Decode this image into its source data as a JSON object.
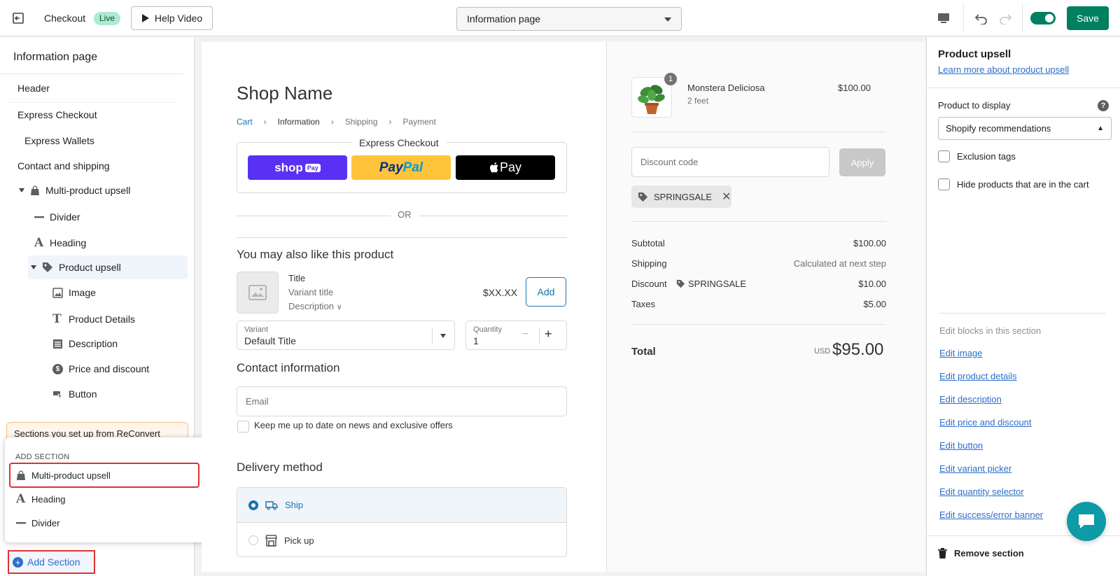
{
  "topbar": {
    "title": "Checkout",
    "status_badge": "Live",
    "help_video_label": "Help Video",
    "page_selector_value": "Information page",
    "save_label": "Save"
  },
  "sidebar": {
    "title": "Information page",
    "items": {
      "header": "Header",
      "express_checkout": "Express Checkout",
      "express_wallets": "Express Wallets",
      "contact_shipping": "Contact and shipping",
      "multi_product_upsell": "Multi-product upsell",
      "divider": "Divider",
      "heading": "Heading",
      "product_upsell": "Product upsell",
      "image": "Image",
      "product_details": "Product Details",
      "description": "Description",
      "price_discount": "Price and discount",
      "button": "Button"
    },
    "notice_text": "Sections you set up from ReConvert",
    "add_section_label": "Add Section"
  },
  "add_section_popover": {
    "title": "ADD SECTION",
    "items": [
      "Multi-product upsell",
      "Heading",
      "Divider"
    ]
  },
  "preview": {
    "shop_name": "Shop Name",
    "breadcrumbs": [
      "Cart",
      "Information",
      "Shipping",
      "Payment"
    ],
    "express_checkout_label": "Express Checkout",
    "shop_pay": {
      "main": "shop",
      "tag": "Pay"
    },
    "paypal": {
      "pay": "Pay",
      "pal": "Pal"
    },
    "apple_pay": "Pay",
    "or_text": "OR",
    "upsell": {
      "heading": "You may also like this product",
      "title": "Title",
      "variant_title": "Variant title",
      "description": "Description",
      "price": "$XX.XX",
      "add_label": "Add",
      "variant_label": "Variant",
      "variant_value": "Default Title",
      "quantity_label": "Quantity",
      "quantity_value": "1"
    },
    "contact_heading": "Contact information",
    "email_placeholder": "Email",
    "newsletter_label": "Keep me up to date on news and exclusive offers",
    "delivery_heading": "Delivery method",
    "delivery_options": {
      "ship": "Ship",
      "pickup": "Pick up"
    }
  },
  "summary": {
    "product": {
      "name": "Monstera Deliciosa",
      "variant": "2 feet",
      "price": "$100.00",
      "quantity": "1"
    },
    "discount_placeholder": "Discount code",
    "apply_label": "Apply",
    "discount_tag": "SPRINGSALE",
    "rows": {
      "subtotal_label": "Subtotal",
      "subtotal_value": "$100.00",
      "shipping_label": "Shipping",
      "shipping_value": "Calculated at next step",
      "discount_label": "Discount",
      "discount_code": "SPRINGSALE",
      "discount_value": "$10.00",
      "taxes_label": "Taxes",
      "taxes_value": "$5.00"
    },
    "total_label": "Total",
    "total_currency": "USD",
    "total_value": "$95.00"
  },
  "right_panel": {
    "title": "Product upsell",
    "learn_more": "Learn more about product upsell",
    "product_to_display_label": "Product to display",
    "product_to_display_value": "Shopify recommendations",
    "exclusion_tags_label": "Exclusion tags",
    "hide_in_cart_label": "Hide products that are in the cart",
    "edit_blocks_heading": "Edit blocks in this section",
    "edit_links": [
      "Edit image",
      "Edit product details",
      "Edit description",
      "Edit price and discount",
      "Edit button",
      "Edit variant picker",
      "Edit quantity selector",
      "Edit success/error banner"
    ],
    "remove_section_label": "Remove section"
  },
  "colors": {
    "primary_green": "#008060",
    "link_blue": "#2c6ecb",
    "checkout_blue": "#1773b0",
    "highlight_red": "#e03131",
    "shop_pay_purple": "#5a31f4",
    "paypal_yellow": "#ffc439",
    "chat_teal": "#0e9aa7"
  }
}
